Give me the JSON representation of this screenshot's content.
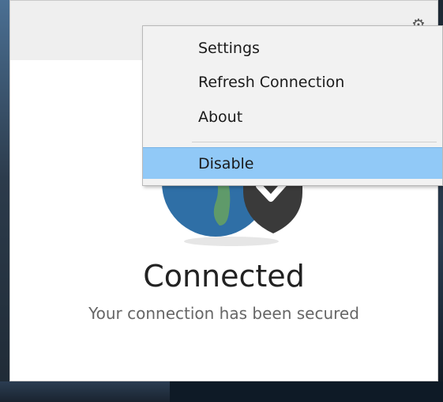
{
  "window": {
    "status_title": "Connected",
    "status_subtitle": "Your connection has been secured",
    "settings_icon": "gear-icon",
    "logo_icon": "globe-shield-logo"
  },
  "context_menu": {
    "items": [
      {
        "label": "Settings"
      },
      {
        "label": "Refresh Connection"
      },
      {
        "label": "About"
      },
      {
        "label": "Disable",
        "highlighted": true
      }
    ]
  },
  "colors": {
    "menu_highlight": "#91c9f7",
    "globe_blue": "#2f6fa6",
    "shield_dark": "#3a3a3a",
    "land_green": "#5f9a6a"
  }
}
